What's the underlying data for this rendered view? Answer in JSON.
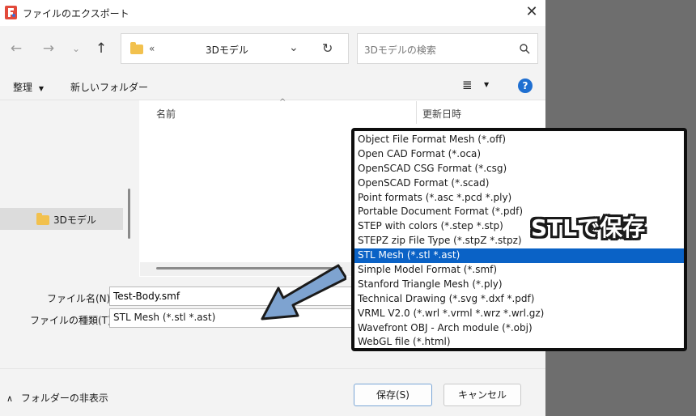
{
  "window": {
    "title": "ファイルのエクスポート"
  },
  "address": {
    "prefix": "«",
    "path": "3Dモデル"
  },
  "search": {
    "placeholder": "3Dモデルの検索"
  },
  "toolbar": {
    "organize": "整理",
    "new_folder": "新しいフォルダー",
    "help": "?"
  },
  "columns": {
    "name": "名前",
    "modified": "更新日時"
  },
  "nav": {
    "selected_folder": "3Dモデル"
  },
  "form": {
    "filename_label": "ファイル名(N):",
    "filename_value": "Test-Body.smf",
    "filetype_label": "ファイルの種類(T):",
    "filetype_value": "STL Mesh (*.stl *.ast)"
  },
  "filetype_options": [
    "Object File Format Mesh (*.off)",
    "Open CAD Format (*.oca)",
    "OpenSCAD CSG Format (*.csg)",
    "OpenSCAD Format (*.scad)",
    "Point formats (*.asc *.pcd *.ply)",
    "Portable Document Format (*.pdf)",
    "STEP with colors (*.step *.stp)",
    "STEPZ zip File Type (*.stpZ *.stpz)",
    "STL Mesh (*.stl *.ast)",
    "Simple Model Format (*.smf)",
    "Stanford Triangle Mesh (*.ply)",
    "Technical Drawing (*.svg *.dxf *.pdf)",
    "VRML V2.0 (*.wrl *.vrml *.wrz *.wrl.gz)",
    "Wavefront OBJ - Arch module (*.obj)",
    "WebGL file (*.html)"
  ],
  "selected_option_index": 8,
  "footer": {
    "hide_folders": "フォルダーの非表示",
    "save": "保存(S)",
    "cancel": "キャンセル"
  },
  "annotation": {
    "callout": "STLで保存"
  },
  "colors": {
    "selection": "#0a62c6",
    "arrow_fill": "#7ea3d0",
    "help_icon": "#1f6fd1"
  }
}
